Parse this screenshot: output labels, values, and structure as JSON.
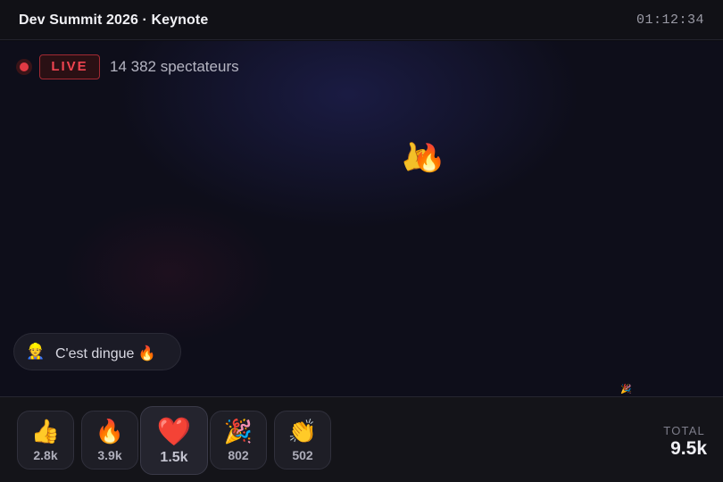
{
  "header": {
    "title": "Dev Summit 2026 · Keynote",
    "timer": "01:12:34"
  },
  "stream": {
    "live_label": "LIVE",
    "viewers": "14 382 spectateurs",
    "floating_reactions": [
      "👍",
      "🔥",
      "🎉"
    ]
  },
  "chat": {
    "avatar": "👷",
    "message": "C'est dingue 🔥"
  },
  "reactions": [
    {
      "emoji": "👍",
      "count": "2.8k"
    },
    {
      "emoji": "🔥",
      "count": "3.9k"
    },
    {
      "emoji": "❤️",
      "count": "1.5k"
    },
    {
      "emoji": "🎉",
      "count": "802"
    },
    {
      "emoji": "👏",
      "count": "502"
    }
  ],
  "totals": {
    "label": "TOTAL",
    "value": "9.5k"
  },
  "colors": {
    "live_red": "#ef4450",
    "background": "#0e0e1a",
    "panel": "#141419"
  }
}
